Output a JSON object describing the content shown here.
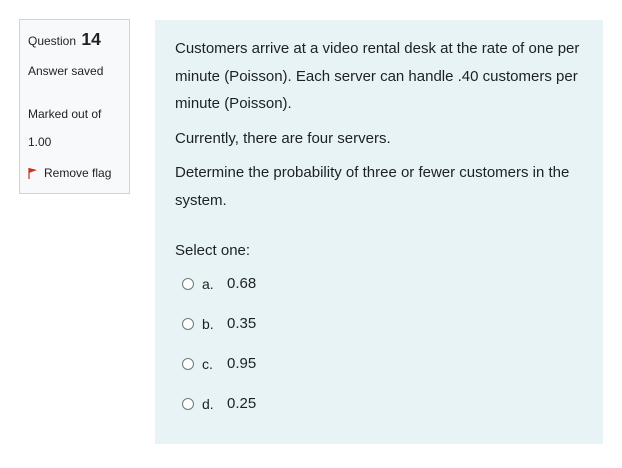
{
  "info": {
    "question_label": "Question",
    "question_number": "14",
    "state": "Answer saved",
    "grade_line1": "Marked out of",
    "grade_line2": "1.00",
    "flag_label": "Remove flag"
  },
  "question": {
    "paragraphs": [
      "Customers arrive at a video rental desk at the rate of one per minute (Poisson). Each server can handle .40 customers per minute (Poisson).",
      "Currently, there are four servers.",
      "Determine the probability of three or fewer customers in the system."
    ],
    "prompt": "Select one:",
    "options": [
      {
        "letter": "a.",
        "value": "0.68"
      },
      {
        "letter": "b.",
        "value": "0.35"
      },
      {
        "letter": "c.",
        "value": "0.95"
      },
      {
        "letter": "d.",
        "value": "0.25"
      }
    ]
  },
  "colors": {
    "content_bg": "#e7f3f5",
    "info_bg": "#f8f9fa",
    "flag_red": "#ca3120"
  }
}
